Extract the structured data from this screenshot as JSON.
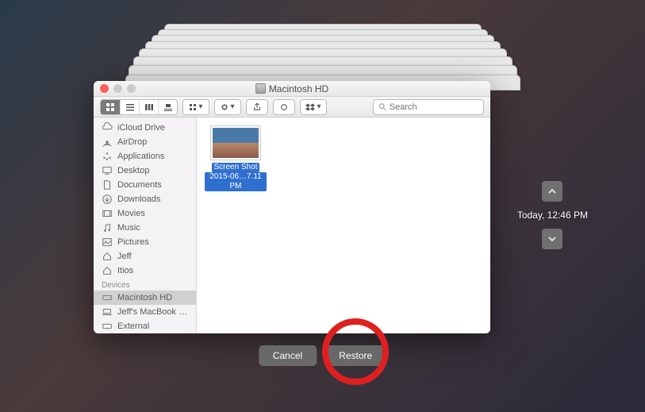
{
  "window": {
    "title": "Macintosh HD"
  },
  "toolbar": {
    "search_placeholder": "Search"
  },
  "sidebar": {
    "favorites": [
      {
        "icon": "cloud",
        "label": "iCloud Drive"
      },
      {
        "icon": "airdrop",
        "label": "AirDrop"
      },
      {
        "icon": "apps",
        "label": "Applications"
      },
      {
        "icon": "desktop",
        "label": "Desktop"
      },
      {
        "icon": "documents",
        "label": "Documents"
      },
      {
        "icon": "downloads",
        "label": "Downloads"
      },
      {
        "icon": "movies",
        "label": "Movies"
      },
      {
        "icon": "music",
        "label": "Music"
      },
      {
        "icon": "pictures",
        "label": "Pictures"
      },
      {
        "icon": "home",
        "label": "Jeff"
      },
      {
        "icon": "home",
        "label": "Itios"
      }
    ],
    "devices_header": "Devices",
    "devices": [
      {
        "icon": "hd",
        "label": "Macintosh HD",
        "selected": true
      },
      {
        "icon": "laptop",
        "label": "Jeff's MacBook Pr…"
      },
      {
        "icon": "hd",
        "label": "External"
      }
    ]
  },
  "file": {
    "name_line1": "Screen Shot",
    "name_line2": "2015-06…7.11 PM"
  },
  "timeline": {
    "timestamp": "Today, 12:46 PM"
  },
  "buttons": {
    "cancel": "Cancel",
    "restore": "Restore"
  }
}
